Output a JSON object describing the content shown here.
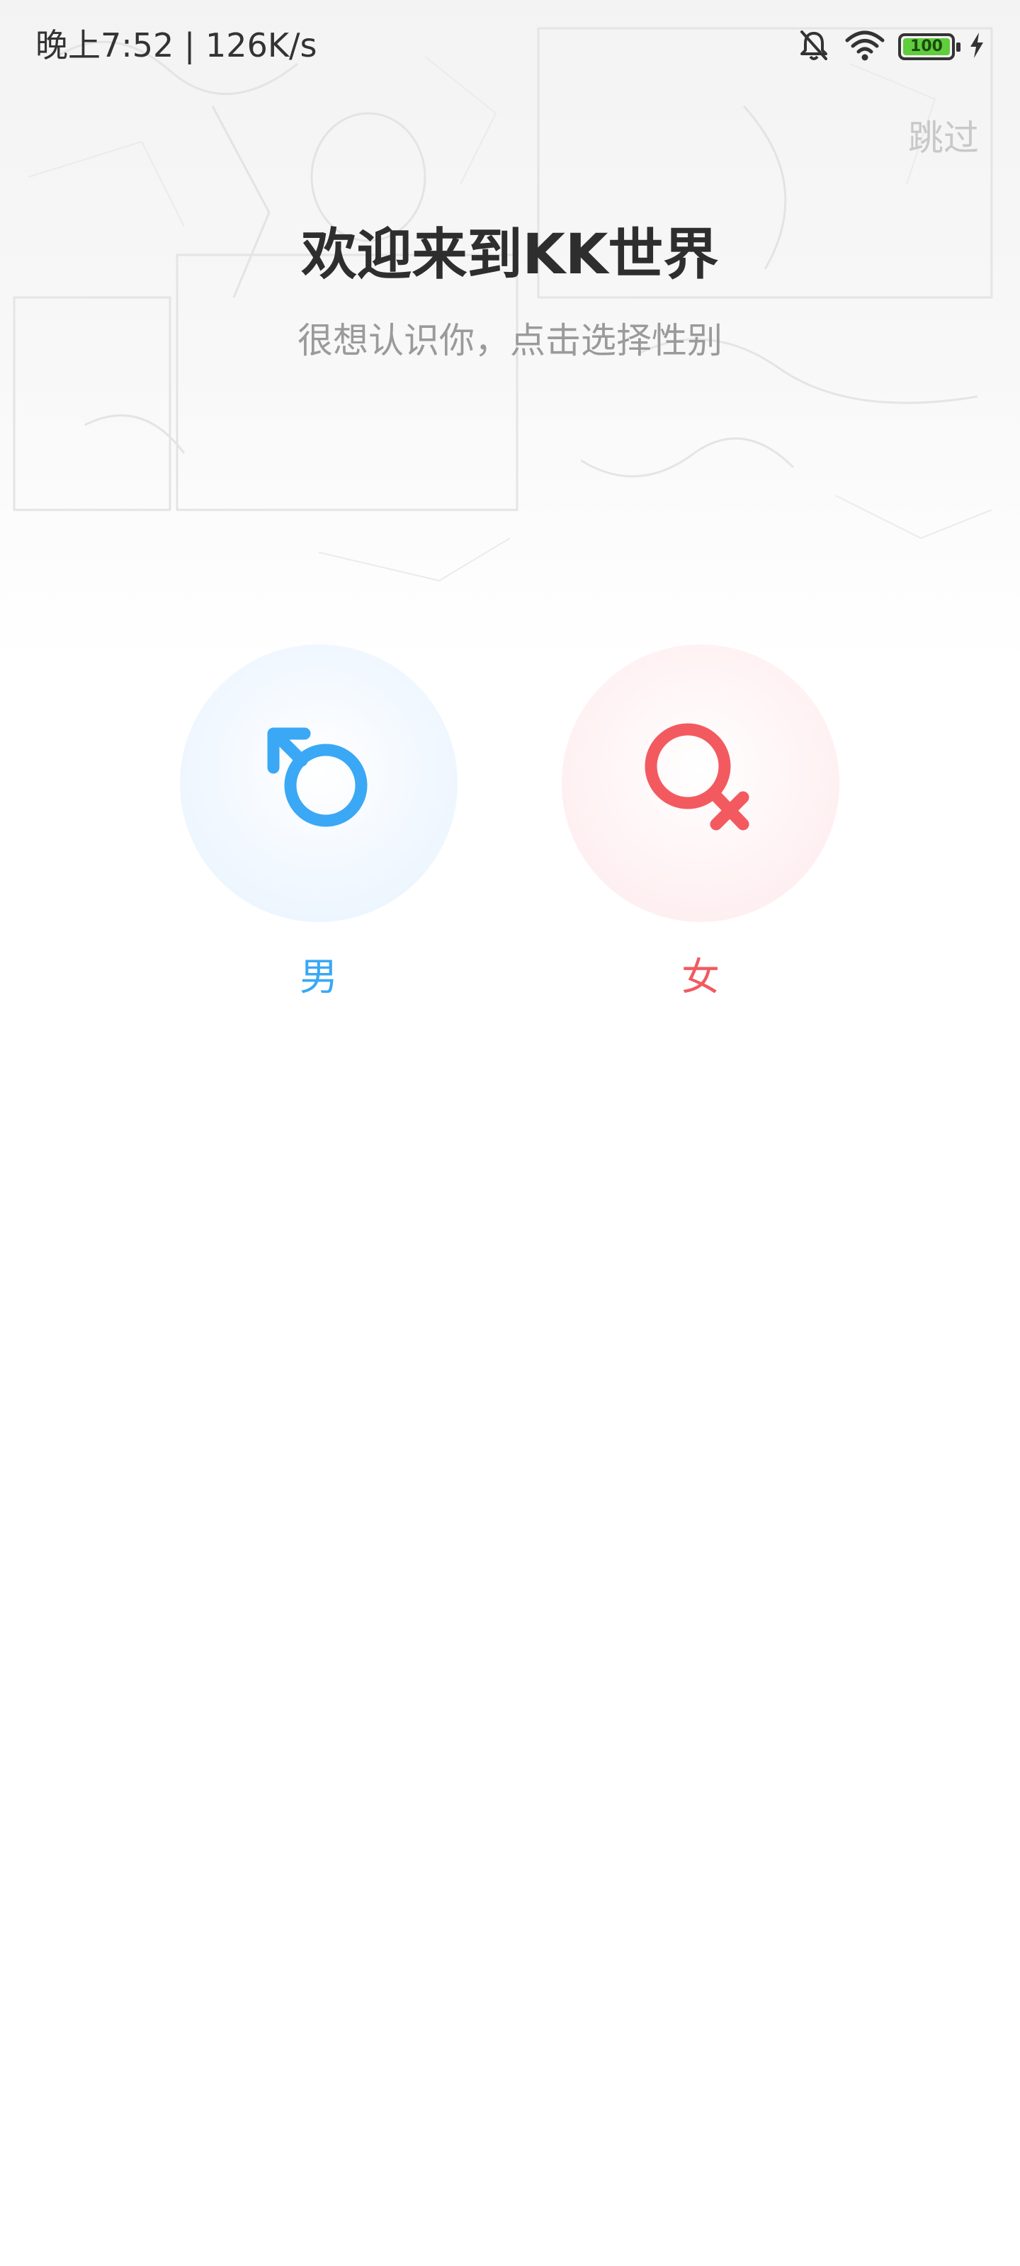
{
  "status_bar": {
    "time_speed": "晚上7:52 | 126K/s",
    "battery_level": "100",
    "icons": [
      "mute-bell-icon",
      "wifi-icon",
      "battery-icon",
      "charging-icon"
    ]
  },
  "header": {
    "skip_label": "跳过",
    "title": "欢迎来到KK世界",
    "subtitle": "很想认识你，点击选择性别"
  },
  "genders": {
    "male": {
      "label": "男",
      "icon": "male-symbol-icon",
      "color": "#3aa8f5"
    },
    "female": {
      "label": "女",
      "icon": "female-symbol-icon",
      "color": "#f25a60"
    }
  }
}
